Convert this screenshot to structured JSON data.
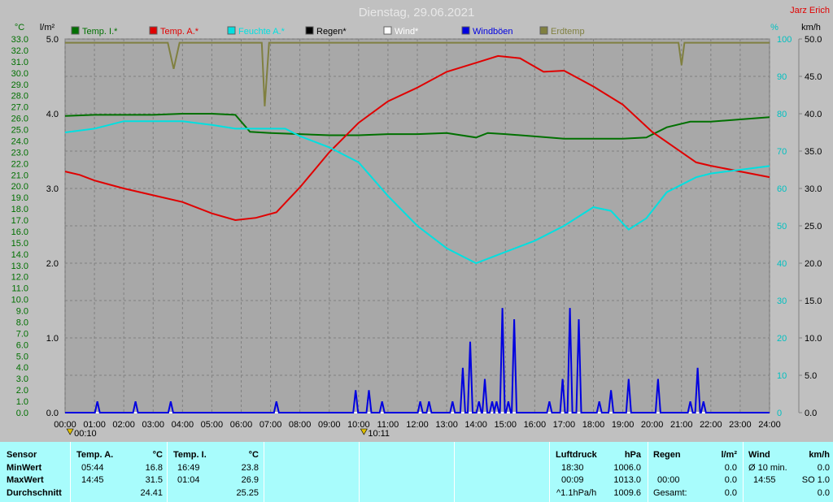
{
  "chart_data": {
    "type": "line",
    "title": "Dienstag, 29.06.2021",
    "station": "Jarz Erich",
    "x_range": [
      "00:00",
      "24:00"
    ],
    "x_ticks": [
      "00:00",
      "01:00",
      "02:00",
      "03:00",
      "04:00",
      "05:00",
      "06:00",
      "07:00",
      "08:00",
      "09:00",
      "10:00",
      "11:00",
      "12:00",
      "13:00",
      "14:00",
      "15:00",
      "16:00",
      "17:00",
      "18:00",
      "19:00",
      "20:00",
      "21:00",
      "22:00",
      "23:00",
      "24:00"
    ],
    "grid": true,
    "legend_position": "top",
    "axes": {
      "temp": {
        "unit": "°C",
        "range": [
          0,
          33
        ],
        "ticks": [
          "0.0",
          "1.0",
          "2.0",
          "3.0",
          "4.0",
          "5.0",
          "6.0",
          "7.0",
          "8.0",
          "9.0",
          "10.0",
          "11.0",
          "12.0",
          "13.0",
          "14.0",
          "15.0",
          "16.0",
          "17.0",
          "18.0",
          "19.0",
          "20.0",
          "21.0",
          "22.0",
          "23.0",
          "24.0",
          "25.0",
          "26.0",
          "27.0",
          "28.0",
          "29.0",
          "30.0",
          "31.0",
          "32.0",
          "33.0"
        ],
        "color": "#007000"
      },
      "rain": {
        "unit": "l/m²",
        "range": [
          0,
          5
        ],
        "ticks": [
          "0.0",
          "1.0",
          "2.0",
          "3.0",
          "4.0",
          "5.0"
        ],
        "color": "#000000"
      },
      "humidity": {
        "unit": "%",
        "range": [
          0,
          100
        ],
        "ticks": [
          "0",
          "10",
          "20",
          "30",
          "40",
          "50",
          "60",
          "70",
          "80",
          "90",
          "100"
        ],
        "color": "#00c0c0"
      },
      "wind": {
        "unit": "km/h",
        "range": [
          0,
          50
        ],
        "ticks": [
          "0.0",
          "5.0",
          "10.0",
          "15.0",
          "20.0",
          "25.0",
          "30.0",
          "35.0",
          "40.0",
          "45.0",
          "50.0"
        ],
        "color": "#000000"
      }
    },
    "series": [
      {
        "name": "Temp. I.*",
        "color": "#007000",
        "axis": "temp",
        "points": [
          [
            0,
            26.2
          ],
          [
            1,
            26.3
          ],
          [
            2,
            26.3
          ],
          [
            3,
            26.3
          ],
          [
            4,
            26.4
          ],
          [
            5,
            26.4
          ],
          [
            5.8,
            26.3
          ],
          [
            6.3,
            24.8
          ],
          [
            7,
            24.7
          ],
          [
            8,
            24.6
          ],
          [
            9,
            24.5
          ],
          [
            10,
            24.5
          ],
          [
            11,
            24.6
          ],
          [
            12,
            24.6
          ],
          [
            13,
            24.7
          ],
          [
            14,
            24.3
          ],
          [
            14.4,
            24.7
          ],
          [
            15,
            24.6
          ],
          [
            16,
            24.4
          ],
          [
            17,
            24.2
          ],
          [
            18,
            24.2
          ],
          [
            19,
            24.2
          ],
          [
            19.8,
            24.3
          ],
          [
            20.5,
            25.2
          ],
          [
            21.3,
            25.7
          ],
          [
            22,
            25.7
          ],
          [
            23,
            25.9
          ],
          [
            24,
            26.1
          ]
        ]
      },
      {
        "name": "Temp. A.*",
        "color": "#e00000",
        "axis": "temp",
        "points": [
          [
            0,
            21.3
          ],
          [
            0.5,
            21.0
          ],
          [
            1,
            20.5
          ],
          [
            2,
            19.8
          ],
          [
            3,
            19.2
          ],
          [
            4,
            18.6
          ],
          [
            5,
            17.6
          ],
          [
            5.8,
            17.0
          ],
          [
            6.5,
            17.2
          ],
          [
            7.2,
            17.7
          ],
          [
            8,
            19.9
          ],
          [
            9,
            23.0
          ],
          [
            10,
            25.6
          ],
          [
            11,
            27.5
          ],
          [
            12,
            28.7
          ],
          [
            13,
            30.1
          ],
          [
            14,
            30.9
          ],
          [
            14.75,
            31.5
          ],
          [
            15.5,
            31.3
          ],
          [
            16.3,
            30.1
          ],
          [
            17,
            30.2
          ],
          [
            17.5,
            29.5
          ],
          [
            18,
            28.8
          ],
          [
            19,
            27.2
          ],
          [
            20,
            24.8
          ],
          [
            21,
            23.0
          ],
          [
            21.5,
            22.1
          ],
          [
            22,
            21.8
          ],
          [
            23,
            21.3
          ],
          [
            24,
            20.8
          ]
        ]
      },
      {
        "name": "Feuchte A.*",
        "color": "#00e0e0",
        "axis": "humidity",
        "points": [
          [
            0,
            75
          ],
          [
            1,
            76
          ],
          [
            2,
            78
          ],
          [
            3,
            78
          ],
          [
            4,
            78
          ],
          [
            5,
            77
          ],
          [
            5.8,
            76
          ],
          [
            6.5,
            76
          ],
          [
            7.5,
            76
          ],
          [
            8,
            74
          ],
          [
            9,
            71
          ],
          [
            10,
            67
          ],
          [
            11,
            58
          ],
          [
            12,
            50
          ],
          [
            13,
            44
          ],
          [
            14,
            40
          ],
          [
            15,
            43
          ],
          [
            16,
            46
          ],
          [
            17,
            50
          ],
          [
            18,
            55
          ],
          [
            18.6,
            54
          ],
          [
            19.2,
            49
          ],
          [
            19.8,
            52
          ],
          [
            20.5,
            59
          ],
          [
            21.5,
            63
          ],
          [
            22,
            64
          ],
          [
            23,
            65
          ],
          [
            24,
            66
          ]
        ]
      },
      {
        "name": "Regen*",
        "color": "#000000",
        "axis": "rain",
        "points": [
          [
            0,
            0
          ],
          [
            24,
            0
          ]
        ]
      },
      {
        "name": "Wind*",
        "color": "#ffffff",
        "axis": "wind",
        "points": [
          [
            0,
            0
          ],
          [
            24,
            0
          ]
        ]
      },
      {
        "name": "Windböen",
        "color": "#0000e0",
        "axis": "wind",
        "type": "spikes",
        "points": [
          [
            1.1,
            1.5
          ],
          [
            2.4,
            1.5
          ],
          [
            3.6,
            1.5
          ],
          [
            7.2,
            1.5
          ],
          [
            9.9,
            3.0
          ],
          [
            10.35,
            3.0
          ],
          [
            10.8,
            1.5
          ],
          [
            12.1,
            1.5
          ],
          [
            12.4,
            1.5
          ],
          [
            13.2,
            1.5
          ],
          [
            13.55,
            6.0
          ],
          [
            13.8,
            9.5
          ],
          [
            14.1,
            1.5
          ],
          [
            14.3,
            4.5
          ],
          [
            14.55,
            1.5
          ],
          [
            14.7,
            1.5
          ],
          [
            14.9,
            14.0
          ],
          [
            15.1,
            1.5
          ],
          [
            15.3,
            12.5
          ],
          [
            16.5,
            1.5
          ],
          [
            16.95,
            4.5
          ],
          [
            17.2,
            14.0
          ],
          [
            17.5,
            12.5
          ],
          [
            18.2,
            1.5
          ],
          [
            18.6,
            3.0
          ],
          [
            19.2,
            4.5
          ],
          [
            20.2,
            4.5
          ],
          [
            21.3,
            1.5
          ],
          [
            21.55,
            6.0
          ],
          [
            21.75,
            1.5
          ]
        ]
      },
      {
        "name": "Erdtemp",
        "color": "#808040",
        "axis": "humidity",
        "points": [
          [
            0,
            99
          ],
          [
            3.5,
            99
          ],
          [
            3.7,
            92
          ],
          [
            3.9,
            99
          ],
          [
            6.7,
            99
          ],
          [
            6.8,
            82
          ],
          [
            6.95,
            99
          ],
          [
            20.9,
            99
          ],
          [
            21.0,
            93
          ],
          [
            21.1,
            99
          ],
          [
            24,
            99
          ]
        ]
      }
    ],
    "markers": [
      {
        "label": "00:10",
        "time": 0.17
      },
      {
        "label": "10:11",
        "time": 10.18
      }
    ]
  },
  "stats": {
    "sensor": {
      "header": "Sensor",
      "rows": [
        "MinWert",
        "MaxWert",
        "Durchschnitt"
      ]
    },
    "temp_a": {
      "header": "Temp. A.",
      "unit": "°C",
      "min_time": "05:44",
      "min": "16.8",
      "max_time": "14:45",
      "max": "31.5",
      "avg": "24.41"
    },
    "temp_i": {
      "header": "Temp. I.",
      "unit": "°C",
      "min_time": "16:49",
      "min": "23.8",
      "max_time": "01:04",
      "max": "26.9",
      "avg": "25.25"
    },
    "pressure": {
      "header": "Luftdruck",
      "unit": "hPa",
      "min_time": "18:30",
      "min": "1006.0",
      "max_time": "00:09",
      "max": "1013.0",
      "trend": "^1.1hPa/h",
      "avg": "1009.6"
    },
    "rain": {
      "header": "Regen",
      "unit": "l/m²",
      "row1": "",
      "val1": "0.0",
      "row2": "00:00",
      "val2": "0.0",
      "row3": "Gesamt:",
      "val3": "0.0"
    },
    "wind": {
      "header": "Wind",
      "unit": "km/h",
      "row1": "Ø 10 min.",
      "val1": "0.0",
      "row2": "14:55",
      "val2": "SO 1.0",
      "val3": "0.0"
    }
  }
}
